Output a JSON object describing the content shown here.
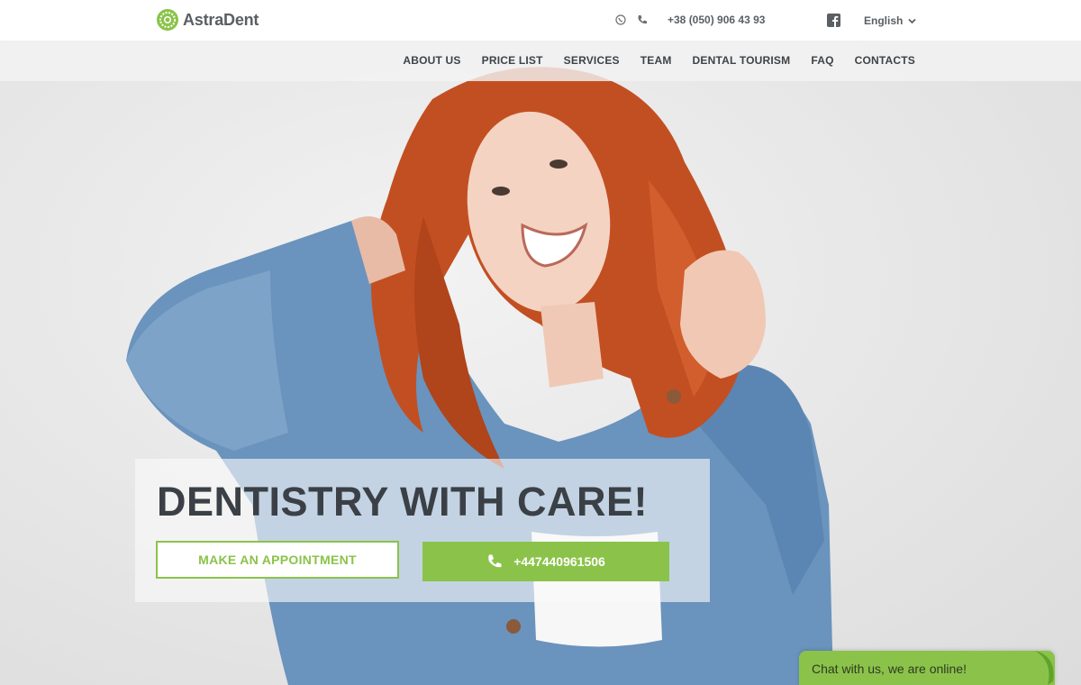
{
  "brand": {
    "name": "AstraDent",
    "accent": "#8bc34a"
  },
  "topbar": {
    "icons": [
      "whatsapp-icon",
      "phone-icon"
    ],
    "phone": "+38 (050) 906 43 93",
    "social_icon": "facebook-icon",
    "language": "English"
  },
  "nav": {
    "items": [
      {
        "label": "ABOUT US"
      },
      {
        "label": "PRICE LIST"
      },
      {
        "label": "SERVICES"
      },
      {
        "label": "TEAM"
      },
      {
        "label": "DENTAL TOURISM"
      },
      {
        "label": "FAQ"
      },
      {
        "label": "CONTACTS"
      }
    ]
  },
  "hero": {
    "headline": "DENTISTRY WITH CARE!",
    "appointment_label": "MAKE AN APPOINTMENT",
    "phone_label": "+447440961506"
  },
  "chat": {
    "label": "Chat with us, we are online!"
  }
}
